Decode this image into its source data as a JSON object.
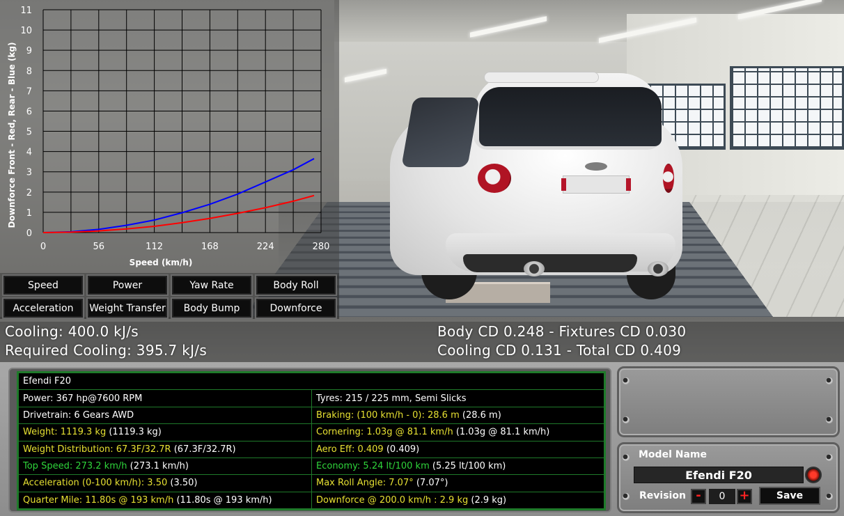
{
  "graph": {
    "y_ticks": [
      "11",
      "10",
      "9",
      "8",
      "7",
      "6",
      "5",
      "4",
      "3",
      "2",
      "1",
      "0"
    ],
    "x_ticks": [
      "0",
      "56",
      "112",
      "168",
      "224",
      "280"
    ],
    "ylabel": "Downforce Front - Red, Rear - Blue (kg)",
    "xlabel": "Speed (km/h)"
  },
  "chart_data": {
    "type": "line",
    "xlabel": "Speed (km/h)",
    "ylabel": "Downforce Front - Red, Rear - Blue (kg)",
    "xlim": [
      0,
      280
    ],
    "ylim": [
      0,
      11
    ],
    "grid": true,
    "x": [
      0,
      28,
      56,
      84,
      112,
      140,
      168,
      196,
      224,
      252,
      273
    ],
    "series": [
      {
        "color": "#0000ff",
        "values": [
          0,
          0.04,
          0.16,
          0.36,
          0.62,
          0.98,
          1.4,
          1.9,
          2.5,
          3.1,
          3.65
        ]
      },
      {
        "color": "#ff0000",
        "values": [
          0,
          0.02,
          0.08,
          0.18,
          0.31,
          0.49,
          0.7,
          0.95,
          1.23,
          1.55,
          1.83
        ]
      }
    ]
  },
  "graph_buttons": [
    "Speed",
    "Power",
    "Yaw Rate",
    "Body Roll",
    "Acceleration",
    "Weight Transfer",
    "Body Bump",
    "Downforce"
  ],
  "cooling": {
    "cooling": "Cooling: 400.0 kJ/s",
    "required": "Required Cooling: 395.7 kJ/s"
  },
  "drag": {
    "line1": "Body CD 0.248 - Fixtures CD 0.030",
    "line2": "Cooling CD 0.131 - Total CD 0.409"
  },
  "stats": {
    "name": "Efendi F20",
    "power": "Power: 367 hp@7600 RPM",
    "tyres": "Tyres: 215 / 225 mm, Semi Slicks",
    "drivetrain": "Drivetrain: 6 Gears AWD",
    "braking": "Braking: (100 km/h - 0): 28.6 m",
    "braking_prev": " (28.6 m)",
    "weight": "Weight: 1119.3 kg",
    "weight_prev": " (1119.3 kg)",
    "cornering": "Cornering: 1.03g @ 81.1 km/h",
    "cornering_prev": " (1.03g @ 81.1 km/h)",
    "weight_dist": "Weight Distribution: 67.3F/32.7R",
    "weight_dist_prev": " (67.3F/32.7R)",
    "aero": "Aero Eff: 0.409",
    "aero_prev": " (0.409)",
    "top_speed": "Top Speed: 273.2 km/h",
    "top_speed_prev": " (273.1 km/h)",
    "economy": "Economy: 5.24 lt/100 km",
    "economy_prev": " (5.25 lt/100 km)",
    "acceleration": "Acceleration (0-100 km/h): 3.50",
    "acceleration_prev": " (3.50)",
    "roll": "Max Roll Angle: 7.07°",
    "roll_prev": " (7.07°)",
    "quarter": "Quarter Mile: 11.80s @ 193 km/h",
    "quarter_prev": " (11.80s @ 193 km/h)",
    "downforce": "Downforce @ 200.0 km/h : 2.9 kg",
    "downforce_prev": " (2.9 kg)"
  },
  "model": {
    "label": "Model Name",
    "name": "Efendi F20",
    "revision_label": "Revision",
    "minus": "-",
    "plus": "+",
    "revision": "0",
    "save": "Save"
  }
}
